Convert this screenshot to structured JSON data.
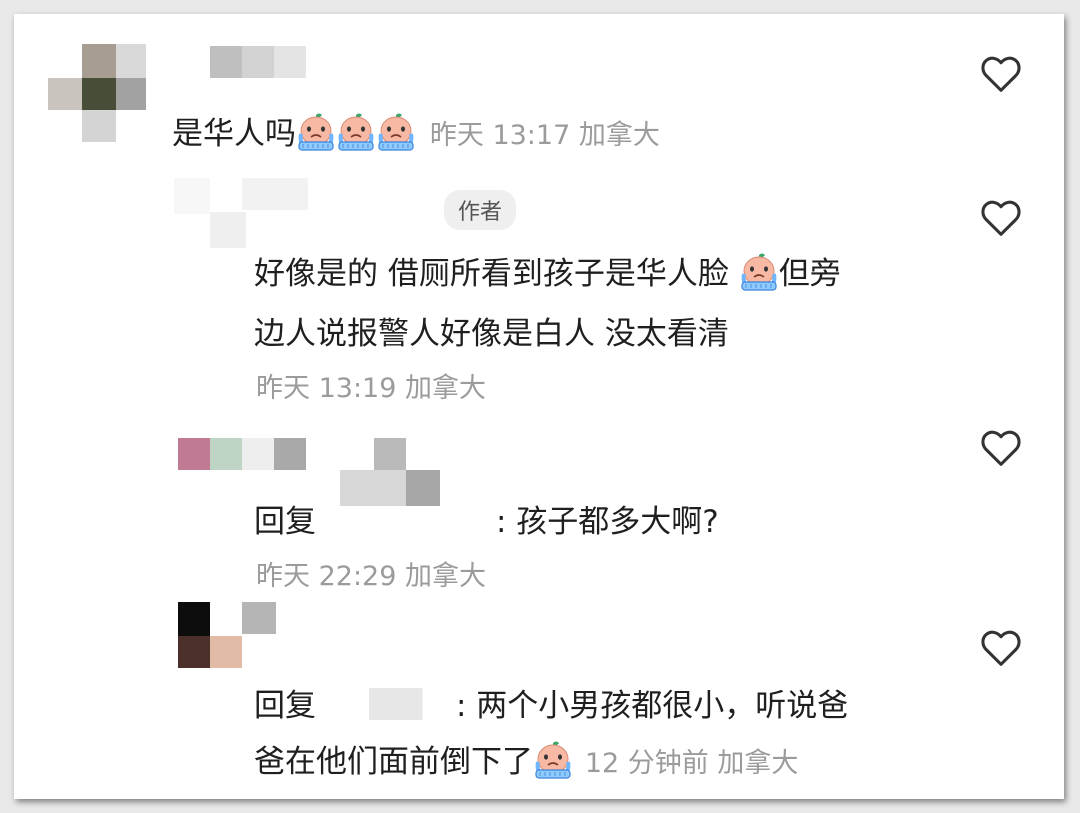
{
  "comments": [
    {
      "text": "是华人吗",
      "emoji_count": 3,
      "time": "昨天 13:17",
      "location": "加拿大"
    },
    {
      "badge": "作者",
      "line1": "好像是的 借厕所看到孩子是华人脸",
      "line1_tail": "但旁",
      "line2": "边人说报警人好像是白人 没太看清",
      "time": "昨天 13:19",
      "location": "加拿大"
    },
    {
      "reply_label": "回复",
      "text": ": 孩子都多大啊?",
      "time": "昨天 22:29",
      "location": "加拿大"
    },
    {
      "reply_label": "回复",
      "line1": ": 两个小男孩都很小，听说爸",
      "line2": "爸在他们面前倒下了",
      "time": "12 分钟前",
      "location": "加拿大"
    }
  ],
  "icons": {
    "like": "heart-outline-icon",
    "emoji": "crying-face-emoji"
  },
  "colors": {
    "text": "#1f1f1f",
    "meta": "#9b9b9b",
    "badge_bg": "#efefef"
  }
}
